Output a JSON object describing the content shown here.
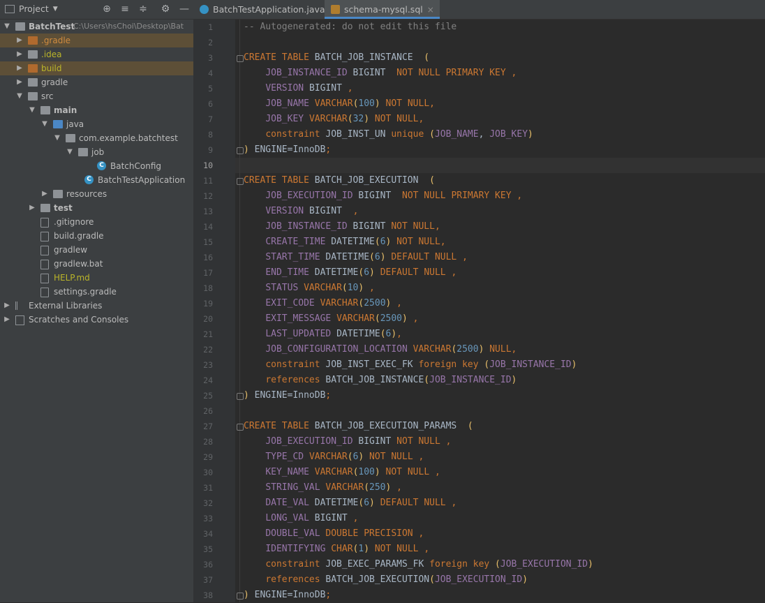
{
  "project_panel": {
    "title": "Project",
    "root": {
      "name": "BatchTest",
      "path": "C:\\Users\\hsChoi\\Desktop\\Bat"
    },
    "items": [
      {
        "label": ".gradle",
        "indent": 1,
        "arrow": "right",
        "icon": "folder-orange",
        "color": "#d08b3f",
        "highlight": true
      },
      {
        "label": ".idea",
        "indent": 1,
        "arrow": "right",
        "icon": "folder",
        "color": "#bbb529",
        "highlight": false
      },
      {
        "label": "build",
        "indent": 1,
        "arrow": "right",
        "icon": "folder-orange",
        "color": "#bbb529",
        "highlight": true
      },
      {
        "label": "gradle",
        "indent": 1,
        "arrow": "right",
        "icon": "folder",
        "color": "#bbbbbb",
        "highlight": false
      },
      {
        "label": "src",
        "indent": 1,
        "arrow": "down",
        "icon": "folder",
        "color": "#bbbbbb",
        "highlight": false
      },
      {
        "label": "main",
        "indent": 2,
        "arrow": "down",
        "icon": "folder",
        "color": "#bbbbbb",
        "bold": true,
        "highlight": false
      },
      {
        "label": "java",
        "indent": 3,
        "arrow": "down",
        "icon": "folder-blue",
        "color": "#bbbbbb",
        "highlight": false
      },
      {
        "label": "com.example.batchtest",
        "indent": 4,
        "arrow": "down",
        "icon": "folder",
        "color": "#bbbbbb",
        "highlight": false
      },
      {
        "label": "job",
        "indent": 5,
        "arrow": "down",
        "icon": "folder",
        "color": "#bbbbbb",
        "highlight": false
      },
      {
        "label": "BatchConfig",
        "indent": 6.5,
        "arrow": "",
        "icon": "class",
        "color": "#bbbbbb",
        "highlight": false
      },
      {
        "label": "BatchTestApplication",
        "indent": 5.5,
        "arrow": "",
        "icon": "class",
        "color": "#bbbbbb",
        "highlight": false
      },
      {
        "label": "resources",
        "indent": 3,
        "arrow": "right",
        "icon": "folder",
        "color": "#bbbbbb",
        "highlight": false
      },
      {
        "label": "test",
        "indent": 2,
        "arrow": "right",
        "icon": "folder",
        "color": "#bbbbbb",
        "bold": true,
        "highlight": false
      },
      {
        "label": ".gitignore",
        "indent": 2,
        "arrow": "",
        "icon": "file",
        "color": "#bbbbbb",
        "highlight": false
      },
      {
        "label": "build.gradle",
        "indent": 2,
        "arrow": "",
        "icon": "file",
        "color": "#bbbbbb",
        "highlight": false
      },
      {
        "label": "gradlew",
        "indent": 2,
        "arrow": "",
        "icon": "file",
        "color": "#bbbbbb",
        "highlight": false
      },
      {
        "label": "gradlew.bat",
        "indent": 2,
        "arrow": "",
        "icon": "file",
        "color": "#bbbbbb",
        "highlight": false
      },
      {
        "label": "HELP.md",
        "indent": 2,
        "arrow": "",
        "icon": "file",
        "color": "#bbb529",
        "highlight": false
      },
      {
        "label": "settings.gradle",
        "indent": 2,
        "arrow": "",
        "icon": "file",
        "color": "#bbbbbb",
        "highlight": false
      },
      {
        "label": "External Libraries",
        "indent": 0,
        "arrow": "right",
        "icon": "library",
        "color": "#bbbbbb",
        "highlight": false
      },
      {
        "label": "Scratches and Consoles",
        "indent": 0,
        "arrow": "right",
        "icon": "scratch",
        "color": "#bbbbbb",
        "highlight": false
      }
    ]
  },
  "tabs": [
    {
      "label": "BatchTestApplication.java",
      "active": false,
      "icon": "class"
    },
    {
      "label": "schema-mysql.sql",
      "active": true,
      "icon": "sql"
    }
  ],
  "editor": {
    "current_line": 10,
    "lines": [
      [
        [
          "c",
          "-- Autogenerated: do not edit this file"
        ]
      ],
      [],
      [
        [
          "k",
          "CREATE TABLE "
        ],
        [
          "i",
          "BATCH_JOB_INSTANCE  "
        ],
        [
          "y",
          "("
        ]
      ],
      [
        [
          "i",
          "    "
        ],
        [
          "cl",
          "JOB_INSTANCE_ID "
        ],
        [
          "i",
          "BIGINT  "
        ],
        [
          "k",
          "NOT NULL PRIMARY KEY "
        ],
        [
          "k",
          ","
        ]
      ],
      [
        [
          "i",
          "    "
        ],
        [
          "cl",
          "VERSION "
        ],
        [
          "i",
          "BIGINT "
        ],
        [
          "k",
          ","
        ]
      ],
      [
        [
          "i",
          "    "
        ],
        [
          "cl",
          "JOB_NAME "
        ],
        [
          "k",
          "VARCHAR"
        ],
        [
          "y",
          "("
        ],
        [
          "n",
          "100"
        ],
        [
          "y",
          ")"
        ],
        [
          "k",
          " NOT NULL,"
        ]
      ],
      [
        [
          "i",
          "    "
        ],
        [
          "cl",
          "JOB_KEY "
        ],
        [
          "k",
          "VARCHAR"
        ],
        [
          "y",
          "("
        ],
        [
          "n",
          "32"
        ],
        [
          "y",
          ")"
        ],
        [
          "k",
          " NOT NULL,"
        ]
      ],
      [
        [
          "i",
          "    "
        ],
        [
          "k",
          "constraint "
        ],
        [
          "i",
          "JOB_INST_UN "
        ],
        [
          "k",
          "unique "
        ],
        [
          "y",
          "("
        ],
        [
          "cl",
          "JOB_NAME"
        ],
        [
          "i",
          ", "
        ],
        [
          "cl",
          "JOB_KEY"
        ],
        [
          "y",
          ")"
        ]
      ],
      [
        [
          "y",
          ")"
        ],
        [
          "i",
          " ENGINE=InnoDB"
        ],
        [
          "k",
          ";"
        ]
      ],
      [],
      [
        [
          "k",
          "CREATE TABLE "
        ],
        [
          "i",
          "BATCH_JOB_EXECUTION  "
        ],
        [
          "y",
          "("
        ]
      ],
      [
        [
          "i",
          "    "
        ],
        [
          "cl",
          "JOB_EXECUTION_ID "
        ],
        [
          "i",
          "BIGINT  "
        ],
        [
          "k",
          "NOT NULL PRIMARY KEY "
        ],
        [
          "k",
          ","
        ]
      ],
      [
        [
          "i",
          "    "
        ],
        [
          "cl",
          "VERSION "
        ],
        [
          "i",
          "BIGINT  "
        ],
        [
          "k",
          ","
        ]
      ],
      [
        [
          "i",
          "    "
        ],
        [
          "cl",
          "JOB_INSTANCE_ID "
        ],
        [
          "i",
          "BIGINT "
        ],
        [
          "k",
          "NOT NULL,"
        ]
      ],
      [
        [
          "i",
          "    "
        ],
        [
          "cl",
          "CREATE_TIME "
        ],
        [
          "i",
          "DATETIME"
        ],
        [
          "y",
          "("
        ],
        [
          "n",
          "6"
        ],
        [
          "y",
          ")"
        ],
        [
          "k",
          " NOT NULL,"
        ]
      ],
      [
        [
          "i",
          "    "
        ],
        [
          "cl",
          "START_TIME "
        ],
        [
          "i",
          "DATETIME"
        ],
        [
          "y",
          "("
        ],
        [
          "n",
          "6"
        ],
        [
          "y",
          ")"
        ],
        [
          "k",
          " DEFAULT NULL "
        ],
        [
          "k",
          ","
        ]
      ],
      [
        [
          "i",
          "    "
        ],
        [
          "cl",
          "END_TIME "
        ],
        [
          "i",
          "DATETIME"
        ],
        [
          "y",
          "("
        ],
        [
          "n",
          "6"
        ],
        [
          "y",
          ")"
        ],
        [
          "k",
          " DEFAULT NULL "
        ],
        [
          "k",
          ","
        ]
      ],
      [
        [
          "i",
          "    "
        ],
        [
          "cl",
          "STATUS "
        ],
        [
          "k",
          "VARCHAR"
        ],
        [
          "y",
          "("
        ],
        [
          "n",
          "10"
        ],
        [
          "y",
          ")"
        ],
        [
          "k",
          " ,"
        ]
      ],
      [
        [
          "i",
          "    "
        ],
        [
          "cl",
          "EXIT_CODE "
        ],
        [
          "k",
          "VARCHAR"
        ],
        [
          "y",
          "("
        ],
        [
          "n",
          "2500"
        ],
        [
          "y",
          ")"
        ],
        [
          "k",
          " ,"
        ]
      ],
      [
        [
          "i",
          "    "
        ],
        [
          "cl",
          "EXIT_MESSAGE "
        ],
        [
          "k",
          "VARCHAR"
        ],
        [
          "y",
          "("
        ],
        [
          "n",
          "2500"
        ],
        [
          "y",
          ")"
        ],
        [
          "k",
          " ,"
        ]
      ],
      [
        [
          "i",
          "    "
        ],
        [
          "cl",
          "LAST_UPDATED "
        ],
        [
          "i",
          "DATETIME"
        ],
        [
          "y",
          "("
        ],
        [
          "n",
          "6"
        ],
        [
          "y",
          ")"
        ],
        [
          "k",
          ","
        ]
      ],
      [
        [
          "i",
          "    "
        ],
        [
          "cl",
          "JOB_CONFIGURATION_LOCATION "
        ],
        [
          "k",
          "VARCHAR"
        ],
        [
          "y",
          "("
        ],
        [
          "n",
          "2500"
        ],
        [
          "y",
          ")"
        ],
        [
          "k",
          " NULL,"
        ]
      ],
      [
        [
          "i",
          "    "
        ],
        [
          "k",
          "constraint "
        ],
        [
          "i",
          "JOB_INST_EXEC_FK "
        ],
        [
          "k",
          "foreign key "
        ],
        [
          "y",
          "("
        ],
        [
          "cl",
          "JOB_INSTANCE_ID"
        ],
        [
          "y",
          ")"
        ]
      ],
      [
        [
          "i",
          "    "
        ],
        [
          "k",
          "references "
        ],
        [
          "i",
          "BATCH_JOB_INSTANCE"
        ],
        [
          "y",
          "("
        ],
        [
          "cl",
          "JOB_INSTANCE_ID"
        ],
        [
          "y",
          ")"
        ]
      ],
      [
        [
          "y",
          ")"
        ],
        [
          "i",
          " ENGINE=InnoDB"
        ],
        [
          "k",
          ";"
        ]
      ],
      [],
      [
        [
          "k",
          "CREATE TABLE "
        ],
        [
          "i",
          "BATCH_JOB_EXECUTION_PARAMS  "
        ],
        [
          "y",
          "("
        ]
      ],
      [
        [
          "i",
          "    "
        ],
        [
          "cl",
          "JOB_EXECUTION_ID "
        ],
        [
          "i",
          "BIGINT "
        ],
        [
          "k",
          "NOT NULL "
        ],
        [
          "k",
          ","
        ]
      ],
      [
        [
          "i",
          "    "
        ],
        [
          "cl",
          "TYPE_CD "
        ],
        [
          "k",
          "VARCHAR"
        ],
        [
          "y",
          "("
        ],
        [
          "n",
          "6"
        ],
        [
          "y",
          ")"
        ],
        [
          "k",
          " NOT NULL "
        ],
        [
          "k",
          ","
        ]
      ],
      [
        [
          "i",
          "    "
        ],
        [
          "cl",
          "KEY_NAME "
        ],
        [
          "k",
          "VARCHAR"
        ],
        [
          "y",
          "("
        ],
        [
          "n",
          "100"
        ],
        [
          "y",
          ")"
        ],
        [
          "k",
          " NOT NULL "
        ],
        [
          "k",
          ","
        ]
      ],
      [
        [
          "i",
          "    "
        ],
        [
          "cl",
          "STRING_VAL "
        ],
        [
          "k",
          "VARCHAR"
        ],
        [
          "y",
          "("
        ],
        [
          "n",
          "250"
        ],
        [
          "y",
          ")"
        ],
        [
          "k",
          " ,"
        ]
      ],
      [
        [
          "i",
          "    "
        ],
        [
          "cl",
          "DATE_VAL "
        ],
        [
          "i",
          "DATETIME"
        ],
        [
          "y",
          "("
        ],
        [
          "n",
          "6"
        ],
        [
          "y",
          ")"
        ],
        [
          "k",
          " DEFAULT NULL "
        ],
        [
          "k",
          ","
        ]
      ],
      [
        [
          "i",
          "    "
        ],
        [
          "cl",
          "LONG_VAL "
        ],
        [
          "i",
          "BIGINT "
        ],
        [
          "k",
          ","
        ]
      ],
      [
        [
          "i",
          "    "
        ],
        [
          "cl",
          "DOUBLE_VAL "
        ],
        [
          "k",
          "DOUBLE PRECISION "
        ],
        [
          "k",
          ","
        ]
      ],
      [
        [
          "i",
          "    "
        ],
        [
          "cl",
          "IDENTIFYING "
        ],
        [
          "k",
          "CHAR"
        ],
        [
          "y",
          "("
        ],
        [
          "n",
          "1"
        ],
        [
          "y",
          ")"
        ],
        [
          "k",
          " NOT NULL "
        ],
        [
          "k",
          ","
        ]
      ],
      [
        [
          "i",
          "    "
        ],
        [
          "k",
          "constraint "
        ],
        [
          "i",
          "JOB_EXEC_PARAMS_FK "
        ],
        [
          "k",
          "foreign key "
        ],
        [
          "y",
          "("
        ],
        [
          "cl",
          "JOB_EXECUTION_ID"
        ],
        [
          "y",
          ")"
        ]
      ],
      [
        [
          "i",
          "    "
        ],
        [
          "k",
          "references "
        ],
        [
          "i",
          "BATCH_JOB_EXECUTION"
        ],
        [
          "y",
          "("
        ],
        [
          "cl",
          "JOB_EXECUTION_ID"
        ],
        [
          "y",
          ")"
        ]
      ],
      [
        [
          "y",
          ")"
        ],
        [
          "i",
          " ENGINE=InnoDB"
        ],
        [
          "k",
          ";"
        ]
      ]
    ],
    "fold_lines": [
      3,
      9,
      11,
      25,
      27,
      38
    ]
  }
}
